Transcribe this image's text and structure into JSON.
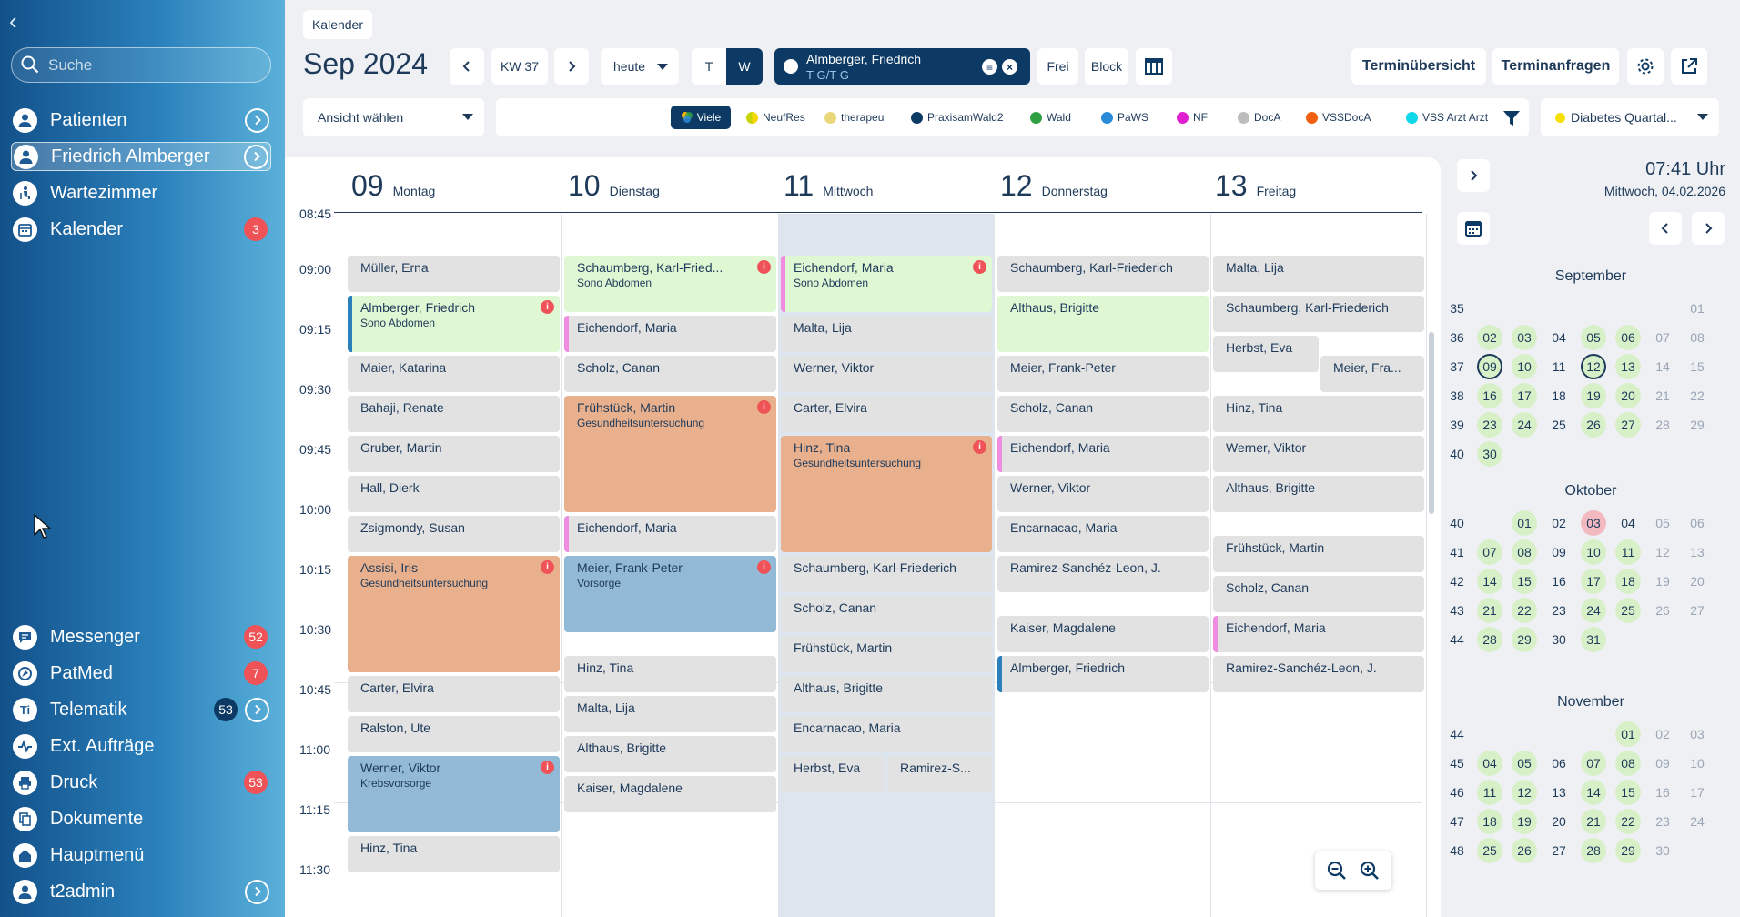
{
  "sidebar": {
    "search_placeholder": "Suche",
    "items": [
      {
        "label": "Patienten",
        "icon": "user-icon"
      },
      {
        "label": "Friedrich Almberger",
        "icon": "user-icon"
      },
      {
        "label": "Wartezimmer",
        "icon": "waiting-room-icon"
      },
      {
        "label": "Kalender",
        "icon": "calendar-icon",
        "badge": "3"
      }
    ],
    "bottom_items": [
      {
        "label": "Messenger",
        "icon": "chat-icon",
        "badge": "52"
      },
      {
        "label": "PatMed",
        "icon": "patmed-icon",
        "badge": "7"
      },
      {
        "label": "Telematik",
        "icon": "ti-icon",
        "badge": "53"
      },
      {
        "label": "Ext. Aufträge",
        "icon": "pulse-icon"
      },
      {
        "label": "Druck",
        "icon": "print-icon",
        "badge": "53"
      },
      {
        "label": "Dokumente",
        "icon": "documents-icon"
      },
      {
        "label": "Hauptmenü",
        "icon": "home-icon"
      },
      {
        "label": "t2admin",
        "icon": "user-icon"
      }
    ],
    "ti_glyph": "Ti"
  },
  "header": {
    "breadcrumb": "Kalender",
    "month": "Sep 2024",
    "week": "KW 37",
    "today_label": "heute",
    "view_day": "T",
    "view_week": "W",
    "patient_name": "Almberger, Friedrich",
    "patient_sub": "T-G/T-G",
    "free_label": "Frei",
    "block_label": "Block",
    "overview_label": "Terminübersicht",
    "requests_label": "Terminanfragen"
  },
  "filters": {
    "view_select": "Ansicht wählen",
    "many_label": "Viele",
    "items": [
      {
        "label": "NeufRes",
        "color": "#c8d400"
      },
      {
        "label": "therapeu",
        "color": "#e8d87a"
      },
      {
        "label": "PraxisamWald2",
        "color": "#0d3a64"
      },
      {
        "label": "Wald",
        "color": "#2ea043"
      },
      {
        "label": "PaWS",
        "color": "#2a8ad8"
      },
      {
        "label": "NF",
        "color": "#e020d0"
      },
      {
        "label": "DocA",
        "color": "#bdbdbd"
      },
      {
        "label": "VSSDocA",
        "color": "#f06010"
      },
      {
        "label": "VSS Arzt Arzt",
        "color": "#10d8e8"
      }
    ],
    "diabetes_label": "Diabetes Quartal...",
    "diabetes_color": "#f5e000"
  },
  "calendar": {
    "days": [
      {
        "num": "09",
        "name": "Montag"
      },
      {
        "num": "10",
        "name": "Dienstag"
      },
      {
        "num": "11",
        "name": "Mittwoch"
      },
      {
        "num": "12",
        "name": "Donnerstag"
      },
      {
        "num": "13",
        "name": "Freitag"
      }
    ],
    "partial_time": "08:45",
    "times": [
      "09:00",
      "09:15",
      "09:30",
      "09:45",
      "10:00",
      "10:15",
      "10:30",
      "10:45",
      "11:00",
      "11:15",
      "11:30"
    ],
    "events": {
      "mon": [
        {
          "name": "Müller, Erna"
        },
        {
          "name": "Almberger, Friedrich",
          "sub": "Sono Abdomen"
        },
        {
          "name": "Maier, Katarina"
        },
        {
          "name": "Bahaji, Renate"
        },
        {
          "name": "Gruber, Martin"
        },
        {
          "name": "Hall, Dierk"
        },
        {
          "name": "Zsigmondy, Susan"
        },
        {
          "name": "Assisi, Iris",
          "sub": "Gesundheitsuntersuchung"
        },
        {
          "name": "Carter, Elvira"
        },
        {
          "name": "Ralston, Ute"
        },
        {
          "name": "Werner, Viktor",
          "sub": "Krebsvorsorge"
        },
        {
          "name": "Hinz, Tina"
        }
      ],
      "tue": [
        {
          "name": "Schaumberg, Karl-Fried...",
          "sub": "Sono Abdomen"
        },
        {
          "name": "Eichendorf, Maria"
        },
        {
          "name": "Scholz, Canan"
        },
        {
          "name": "Frühstück, Martin",
          "sub": "Gesundheitsuntersuchung"
        },
        {
          "name": "Eichendorf, Maria"
        },
        {
          "name": "Meier, Frank-Peter",
          "sub": "Vorsorge"
        },
        {
          "name": "Hinz, Tina"
        },
        {
          "name": "Malta, Lija"
        },
        {
          "name": "Althaus, Brigitte"
        },
        {
          "name": "Kaiser, Magdalene"
        }
      ],
      "wed": [
        {
          "name": "Eichendorf, Maria",
          "sub": "Sono Abdomen"
        },
        {
          "name": "Malta, Lija"
        },
        {
          "name": "Werner, Viktor"
        },
        {
          "name": "Carter, Elvira"
        },
        {
          "name": "Hinz, Tina",
          "sub": "Gesundheitsuntersuchung"
        },
        {
          "name": "Schaumberg, Karl-Friederich"
        },
        {
          "name": "Scholz, Canan"
        },
        {
          "name": "Frühstück, Martin"
        },
        {
          "name": "Althaus, Brigitte"
        },
        {
          "name": "Encarnacao, Maria"
        },
        {
          "name": "Herbst, Eva"
        },
        {
          "name": "Ramirez-S..."
        }
      ],
      "thu": [
        {
          "name": "Schaumberg, Karl-Friederich"
        },
        {
          "name": "Althaus, Brigitte"
        },
        {
          "name": "Meier, Frank-Peter"
        },
        {
          "name": "Scholz, Canan"
        },
        {
          "name": "Eichendorf, Maria"
        },
        {
          "name": "Werner, Viktor"
        },
        {
          "name": "Encarnacao, Maria"
        },
        {
          "name": "Ramirez-Sanchéz-Leon, J."
        },
        {
          "name": "Kaiser, Magdalene"
        },
        {
          "name": "Almberger, Friedrich"
        }
      ],
      "fri": [
        {
          "name": "Malta, Lija"
        },
        {
          "name": "Schaumberg, Karl-Friederich"
        },
        {
          "name": "Herbst, Eva"
        },
        {
          "name": "Meier, Fra..."
        },
        {
          "name": "Hinz, Tina"
        },
        {
          "name": "Werner, Viktor"
        },
        {
          "name": "Althaus, Brigitte"
        },
        {
          "name": "Frühstück, Martin"
        },
        {
          "name": "Scholz, Canan"
        },
        {
          "name": "Eichendorf, Maria"
        },
        {
          "name": "Ramirez-Sanchéz-Leon, J."
        }
      ]
    }
  },
  "right_pane": {
    "time": "07:41 Uhr",
    "date": "Mittwoch, 04.02.2026",
    "months": [
      {
        "name": "September",
        "rows": [
          {
            "wk": "35",
            "days": [
              "",
              "",
              "",
              "",
              "",
              "",
              "01"
            ]
          },
          {
            "wk": "36",
            "days": [
              "02",
              "03",
              "04",
              "05",
              "06",
              "07",
              "08"
            ]
          },
          {
            "wk": "37",
            "days": [
              "09",
              "10",
              "11",
              "12",
              "13",
              "14",
              "15"
            ]
          },
          {
            "wk": "38",
            "days": [
              "16",
              "17",
              "18",
              "19",
              "20",
              "21",
              "22"
            ]
          },
          {
            "wk": "39",
            "days": [
              "23",
              "24",
              "25",
              "26",
              "27",
              "28",
              "29"
            ]
          },
          {
            "wk": "40",
            "days": [
              "30",
              "",
              "",
              "",
              "",
              "",
              ""
            ]
          }
        ]
      },
      {
        "name": "Oktober",
        "rows": [
          {
            "wk": "40",
            "days": [
              "",
              "01",
              "02",
              "03",
              "04",
              "05",
              "06"
            ]
          },
          {
            "wk": "41",
            "days": [
              "07",
              "08",
              "09",
              "10",
              "11",
              "12",
              "13"
            ]
          },
          {
            "wk": "42",
            "days": [
              "14",
              "15",
              "16",
              "17",
              "18",
              "19",
              "20"
            ]
          },
          {
            "wk": "43",
            "days": [
              "21",
              "22",
              "23",
              "24",
              "25",
              "26",
              "27"
            ]
          },
          {
            "wk": "44",
            "days": [
              "28",
              "29",
              "30",
              "31",
              "",
              "",
              ""
            ]
          }
        ]
      },
      {
        "name": "November",
        "rows": [
          {
            "wk": "44",
            "days": [
              "",
              "",
              "",
              "",
              "01",
              "02",
              "03"
            ]
          },
          {
            "wk": "45",
            "days": [
              "04",
              "05",
              "06",
              "07",
              "08",
              "09",
              "10"
            ]
          },
          {
            "wk": "46",
            "days": [
              "11",
              "12",
              "13",
              "14",
              "15",
              "16",
              "17"
            ]
          },
          {
            "wk": "47",
            "days": [
              "18",
              "19",
              "20",
              "21",
              "22",
              "23",
              "24"
            ]
          },
          {
            "wk": "48",
            "days": [
              "25",
              "26",
              "27",
              "28",
              "29",
              "30",
              ""
            ]
          }
        ]
      }
    ]
  },
  "colors": {
    "navy": "#0d3a64",
    "accent_blue": "#2a80bb",
    "badge_red": "#ef5358",
    "event_grey": "#e2e2e2",
    "event_green": "#e0f7d4",
    "event_orange": "#e8b08c",
    "event_blue": "#92bad6",
    "avail_green": "#d8f0c8"
  }
}
